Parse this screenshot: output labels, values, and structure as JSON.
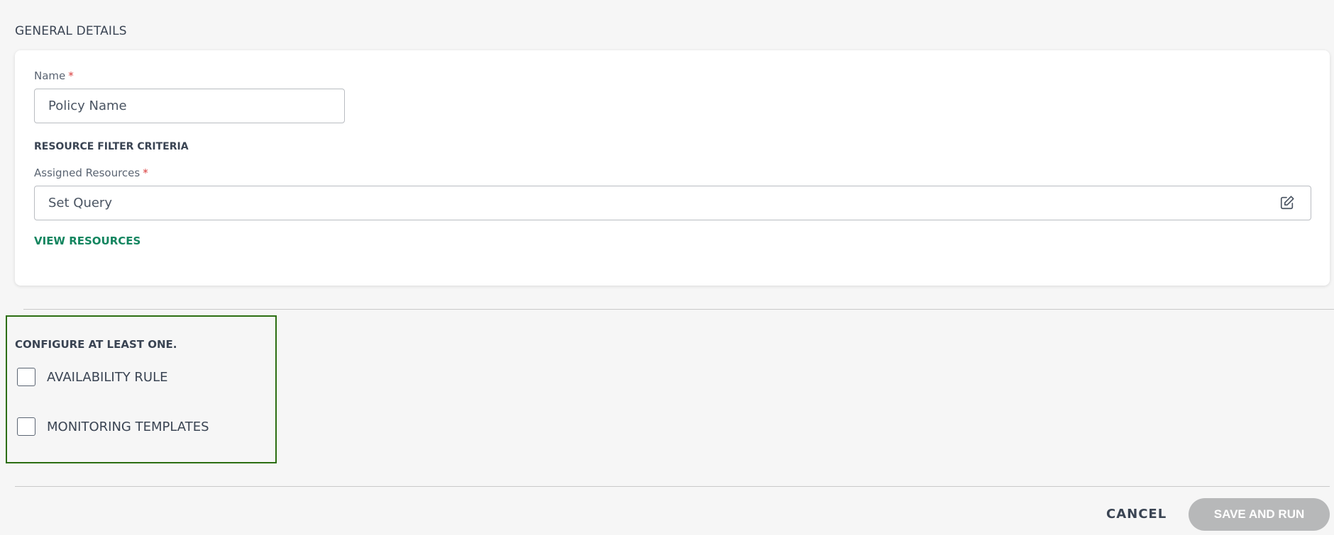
{
  "general": {
    "title": "GENERAL DETAILS"
  },
  "name_field": {
    "label": "Name",
    "required": "*",
    "placeholder": "Policy Name"
  },
  "resource_filter": {
    "title": "RESOURCE FILTER CRITERIA",
    "assigned_label": "Assigned Resources",
    "required": "*",
    "query_placeholder": "Set Query",
    "edit_icon": "edit-icon",
    "view_link": "VIEW RESOURCES"
  },
  "configure": {
    "title": "CONFIGURE AT LEAST ONE.",
    "options": [
      {
        "label": "AVAILABILITY RULE",
        "checked": false
      },
      {
        "label": "MONITORING TEMPLATES",
        "checked": false
      }
    ],
    "highlight_color": "#2c6e12"
  },
  "actions": {
    "cancel": "CANCEL",
    "save_run": "SAVE AND RUN"
  },
  "colors": {
    "link": "#13855f",
    "required": "#d93b3b",
    "disabled_button": "#b7b8b9"
  }
}
